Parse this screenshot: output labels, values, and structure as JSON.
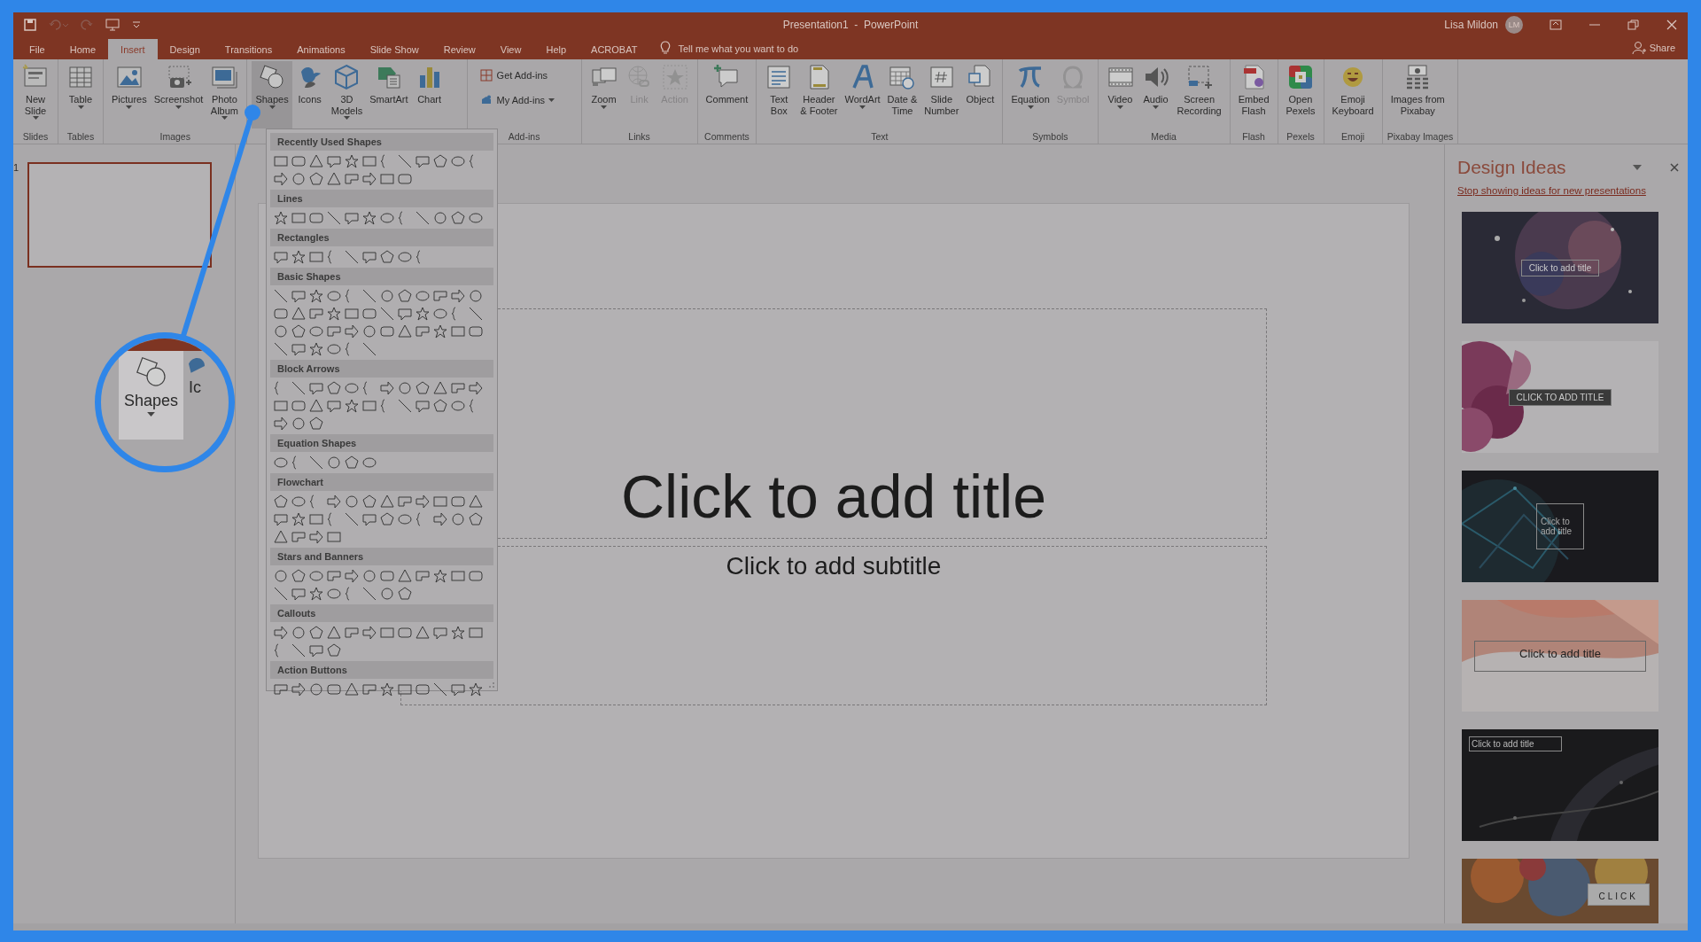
{
  "title_bar": {
    "title": "Presentation1  -  PowerPoint",
    "user": "Lisa Mildon",
    "avatar": "LM"
  },
  "tabs": [
    {
      "label": "File",
      "selected": false
    },
    {
      "label": "Home",
      "selected": false
    },
    {
      "label": "Insert",
      "selected": true
    },
    {
      "label": "Design",
      "selected": false
    },
    {
      "label": "Transitions",
      "selected": false
    },
    {
      "label": "Animations",
      "selected": false
    },
    {
      "label": "Slide Show",
      "selected": false
    },
    {
      "label": "Review",
      "selected": false
    },
    {
      "label": "View",
      "selected": false
    },
    {
      "label": "Help",
      "selected": false
    },
    {
      "label": "ACROBAT",
      "selected": false
    }
  ],
  "tell_me": "Tell me what you want to do",
  "share": "Share",
  "ribbon": [
    {
      "label": "Slides",
      "items": [
        {
          "kind": "large",
          "label": "New\nSlide",
          "dropdown": true,
          "disabled": false,
          "pressed": false
        }
      ]
    },
    {
      "label": "Tables",
      "items": [
        {
          "kind": "large",
          "label": "Table",
          "dropdown": true,
          "disabled": false,
          "pressed": false
        }
      ]
    },
    {
      "label": "Images",
      "items": [
        {
          "kind": "large",
          "label": "Pictures",
          "dropdown": true,
          "disabled": false,
          "pressed": false
        },
        {
          "kind": "large",
          "label": "Screenshot",
          "dropdown": true,
          "disabled": false,
          "pressed": false
        },
        {
          "kind": "large",
          "label": "Photo\nAlbum",
          "dropdown": true,
          "disabled": false,
          "pressed": false
        }
      ]
    },
    {
      "items": [
        {
          "kind": "large",
          "label": "Shapes",
          "dropdown": true,
          "disabled": false,
          "pressed": true
        },
        {
          "kind": "large",
          "label": "Icons",
          "dropdown": false,
          "disabled": false,
          "pressed": false
        },
        {
          "kind": "large",
          "label": "3D\nModels",
          "dropdown": true,
          "disabled": false,
          "pressed": false
        },
        {
          "kind": "large",
          "label": "SmartArt",
          "dropdown": false,
          "disabled": false,
          "pressed": false
        },
        {
          "kind": "large",
          "label": "Chart",
          "dropdown": false,
          "disabled": false,
          "pressed": false
        }
      ]
    },
    {
      "label": "Add-ins",
      "items": [
        {
          "kind": "small",
          "label": "Get Add-ins",
          "dropdown": false,
          "disabled": false,
          "pressed": false
        },
        {
          "kind": "small",
          "label": "My Add-ins",
          "dropdown": true,
          "disabled": false,
          "pressed": false
        }
      ]
    },
    {
      "label": "Links",
      "items": [
        {
          "kind": "large",
          "label": "Zoom",
          "dropdown": true,
          "disabled": false,
          "pressed": false
        },
        {
          "kind": "large",
          "label": "Link",
          "dropdown": false,
          "disabled": true,
          "pressed": false
        },
        {
          "kind": "large",
          "label": "Action",
          "dropdown": false,
          "disabled": true,
          "pressed": false
        }
      ]
    },
    {
      "label": "Comments",
      "items": [
        {
          "kind": "large",
          "label": "Comment",
          "dropdown": false,
          "disabled": false,
          "pressed": false
        }
      ]
    },
    {
      "label": "Text",
      "items": [
        {
          "kind": "large",
          "label": "Text\nBox",
          "dropdown": false,
          "disabled": false,
          "pressed": false
        },
        {
          "kind": "large",
          "label": "Header\n& Footer",
          "dropdown": false,
          "disabled": false,
          "pressed": false
        },
        {
          "kind": "large",
          "label": "WordArt",
          "dropdown": true,
          "disabled": false,
          "pressed": false
        },
        {
          "kind": "large",
          "label": "Date &\nTime",
          "dropdown": false,
          "disabled": false,
          "pressed": false
        },
        {
          "kind": "large",
          "label": "Slide\nNumber",
          "dropdown": false,
          "disabled": false,
          "pressed": false
        },
        {
          "kind": "large",
          "label": "Object",
          "dropdown": false,
          "disabled": false,
          "pressed": false
        }
      ]
    },
    {
      "label": "Symbols",
      "items": [
        {
          "kind": "large",
          "label": "Equation",
          "dropdown": true,
          "disabled": false,
          "pressed": false
        },
        {
          "kind": "large",
          "label": "Symbol",
          "dropdown": false,
          "disabled": true,
          "pressed": false
        }
      ]
    },
    {
      "label": "Media",
      "items": [
        {
          "kind": "large",
          "label": "Video",
          "dropdown": true,
          "disabled": false,
          "pressed": false
        },
        {
          "kind": "large",
          "label": "Audio",
          "dropdown": true,
          "disabled": false,
          "pressed": false
        },
        {
          "kind": "large",
          "label": "Screen\nRecording",
          "dropdown": false,
          "disabled": false,
          "pressed": false
        }
      ]
    },
    {
      "label": "Flash",
      "items": [
        {
          "kind": "large",
          "label": "Embed\nFlash",
          "dropdown": false,
          "disabled": false,
          "pressed": false
        }
      ]
    },
    {
      "label": "Pexels",
      "items": [
        {
          "kind": "large",
          "label": "Open\nPexels",
          "dropdown": false,
          "disabled": false,
          "pressed": false
        }
      ]
    },
    {
      "label": "Emoji",
      "items": [
        {
          "kind": "large",
          "label": "Emoji\nKeyboard",
          "dropdown": false,
          "disabled": false,
          "pressed": false
        }
      ]
    },
    {
      "label": "Pixabay Images",
      "items": [
        {
          "kind": "large",
          "label": "Images from\nPixabay",
          "dropdown": false,
          "disabled": false,
          "pressed": false
        }
      ]
    }
  ],
  "shapes_menu": {
    "sections": [
      {
        "title": "Recently Used Shapes"
      },
      {
        "title": "Lines"
      },
      {
        "title": "Rectangles"
      },
      {
        "title": "Basic Shapes"
      },
      {
        "title": "Block Arrows"
      },
      {
        "title": "Equation Shapes"
      },
      {
        "title": "Flowchart"
      },
      {
        "title": "Stars and Banners"
      },
      {
        "title": "Callouts"
      },
      {
        "title": "Action Buttons"
      }
    ]
  },
  "slide_panel": {
    "number": "1"
  },
  "slide": {
    "title_placeholder": "Click to add title",
    "subtitle_placeholder": "Click to add subtitle"
  },
  "design_ideas": {
    "title": "Design Ideas",
    "link": "Stop showing ideas for new presentations",
    "designs": [
      {
        "title": "Click to add title"
      },
      {
        "title": "CLICK TO ADD TITLE"
      },
      {
        "title": "Click to add title"
      },
      {
        "title": "Click to add title"
      },
      {
        "title": "Click to add title"
      },
      {
        "title": "CLICK"
      }
    ]
  },
  "callout": {
    "label": "Shapes",
    "next_label": "Ic"
  }
}
